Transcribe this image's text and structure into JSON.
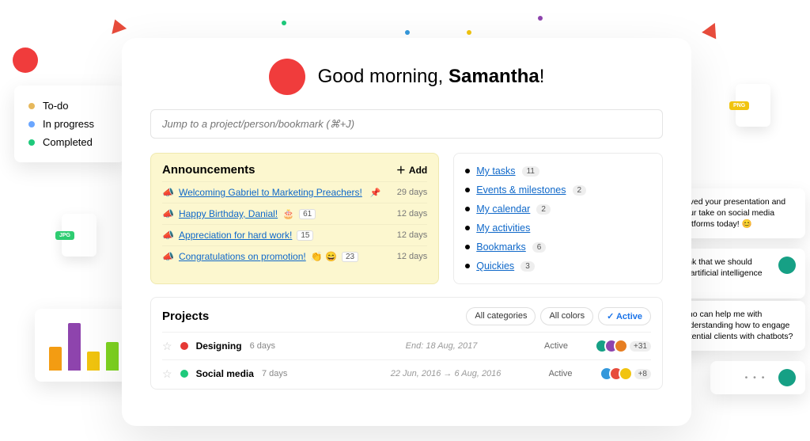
{
  "greeting_prefix": "Good morning, ",
  "greeting_name": "Samantha",
  "greeting_suffix": "!",
  "search_placeholder": "Jump to a project/person/bookmark (⌘+J)",
  "legend": {
    "items": [
      {
        "label": "To-do",
        "color": "#e6b85c"
      },
      {
        "label": "In progress",
        "color": "#6aa6ff"
      },
      {
        "label": "Completed",
        "color": "#1ec97b"
      }
    ]
  },
  "file_chips": {
    "jpg": "JPG",
    "png": "PNG"
  },
  "announcements": {
    "title": "Announcements",
    "add_label": "Add",
    "items": [
      {
        "text": "Welcoming Gabriel to Marketing Preachers!",
        "pinned": true,
        "time": "29 days",
        "emoji": "",
        "count": ""
      },
      {
        "text": "Happy Birthday, Danial!",
        "pinned": false,
        "time": "12 days",
        "emoji": "🎂",
        "count": "61"
      },
      {
        "text": "Appreciation for hard work!",
        "pinned": false,
        "time": "12 days",
        "emoji": "",
        "count": "15"
      },
      {
        "text": "Congratulations on promotion!",
        "pinned": false,
        "time": "12 days",
        "emoji": "👏 😄",
        "count": "23"
      }
    ]
  },
  "quicklinks": [
    {
      "label": "My tasks",
      "count": "11"
    },
    {
      "label": "Events & milestones",
      "count": "2"
    },
    {
      "label": "My calendar",
      "count": "2"
    },
    {
      "label": "My activities",
      "count": ""
    },
    {
      "label": "Bookmarks",
      "count": "6"
    },
    {
      "label": "Quickies",
      "count": "3"
    }
  ],
  "projects": {
    "title": "Projects",
    "filters": {
      "cat": "All categories",
      "colors": "All colors",
      "active": "Active"
    },
    "rows": [
      {
        "color": "#e53935",
        "name": "Designing",
        "age": "6 days",
        "dates": "End: 18 Aug, 2017",
        "status": "Active",
        "more": "+31"
      },
      {
        "color": "#1ec97b",
        "name": "Social media",
        "age": "7 days",
        "dates": "22 Jun, 2016 → 6 Aug, 2016",
        "status": "Active",
        "more": "+8"
      }
    ]
  },
  "chats": [
    {
      "text": "Loved your presentation and your take on social media platforms today! 😊",
      "color": "#8e44ad"
    },
    {
      "text": "I also think that we should consider artificial intelligence too. 😊",
      "color": "#16a085"
    },
    {
      "text": "Who can help me with understanding how to engage potential clients with chatbots?",
      "color": "#d35400"
    }
  ]
}
